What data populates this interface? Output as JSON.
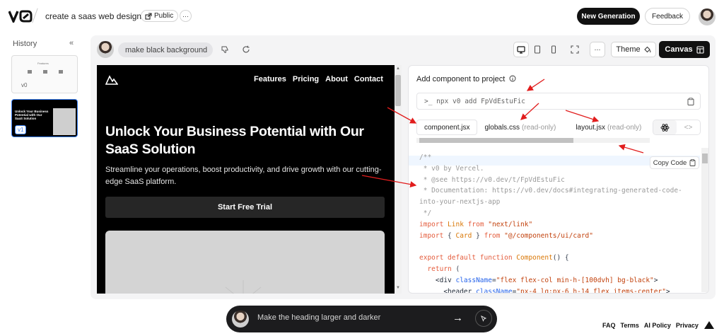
{
  "header": {
    "project_title": "create a saas web design",
    "public_label": "Public",
    "more_label": "···",
    "new_generation_label": "New Generation",
    "feedback_label": "Feedback"
  },
  "history": {
    "title": "History",
    "collapse_icon": "«",
    "items": [
      {
        "version": "v0"
      },
      {
        "version": "v1",
        "thumb_heading": "Unlock Your Business Potential with Our SaaS Solution"
      }
    ],
    "thumb1_title": "Features"
  },
  "toolbar": {
    "prompt_label": "make black background",
    "theme_label": "Theme",
    "canvas_label": "Canvas",
    "more_label": "···"
  },
  "preview": {
    "nav": [
      "Features",
      "Pricing",
      "About",
      "Contact"
    ],
    "heading": "Unlock Your Business Potential with Our SaaS Solution",
    "subheading": "Streamline your operations, boost productivity, and drive growth with our cutting-edge SaaS platform.",
    "cta_label": "Start Free Trial"
  },
  "code_panel": {
    "add_title": "Add component to project",
    "command": ">_  npx v0 add FpVdEstuFic",
    "tabs": [
      {
        "label": "component.jsx",
        "readonly": ""
      },
      {
        "label": "globals.css",
        "readonly": "(read-only)"
      },
      {
        "label": "layout.jsx",
        "readonly": "(read-only)"
      }
    ],
    "copy_label": "Copy Code",
    "code_lines": [
      [
        {
          "t": "/**",
          "c": "com"
        }
      ],
      [
        {
          "t": " * v0 by Vercel.",
          "c": "com"
        }
      ],
      [
        {
          "t": " * @see https://v0.dev/t/FpVdEstuFic",
          "c": "com"
        }
      ],
      [
        {
          "t": " * Documentation: https://v0.dev/docs#integrating-generated-code-",
          "c": "com"
        }
      ],
      [
        {
          "t": "into-your-nextjs-app",
          "c": "com"
        }
      ],
      [
        {
          "t": " */",
          "c": "com"
        }
      ],
      [
        {
          "t": "import ",
          "c": "kw"
        },
        {
          "t": "Link ",
          "c": "fn"
        },
        {
          "t": "from ",
          "c": "kw"
        },
        {
          "t": "\"next/link\"",
          "c": "str"
        }
      ],
      [
        {
          "t": "import ",
          "c": "kw"
        },
        {
          "t": "{ ",
          "c": "plain"
        },
        {
          "t": "Card ",
          "c": "fn"
        },
        {
          "t": "} ",
          "c": "plain"
        },
        {
          "t": "from ",
          "c": "kw"
        },
        {
          "t": "\"@/components/ui/card\"",
          "c": "str"
        }
      ],
      [
        {
          "t": "",
          "c": "plain"
        }
      ],
      [
        {
          "t": "export default function ",
          "c": "kw"
        },
        {
          "t": "Component",
          "c": "fn"
        },
        {
          "t": "() {",
          "c": "plain"
        }
      ],
      [
        {
          "t": "  return ",
          "c": "kw"
        },
        {
          "t": "(",
          "c": "plain"
        }
      ],
      [
        {
          "t": "    <div ",
          "c": "tag"
        },
        {
          "t": "className",
          "c": "attr"
        },
        {
          "t": "=",
          "c": "plain"
        },
        {
          "t": "\"flex flex-col min-h-[100dvh] bg-black\"",
          "c": "str"
        },
        {
          "t": ">",
          "c": "tag"
        }
      ],
      [
        {
          "t": "      <header ",
          "c": "tag"
        },
        {
          "t": "className",
          "c": "attr"
        },
        {
          "t": "=",
          "c": "plain"
        },
        {
          "t": "\"px-4 lg:px-6 h-14 flex items-center\"",
          "c": "str"
        },
        {
          "t": ">",
          "c": "tag"
        }
      ]
    ]
  },
  "chat": {
    "input_value": "Make the heading larger and darker"
  },
  "footer": {
    "links": [
      "FAQ",
      "Terms",
      "AI Policy",
      "Privacy"
    ]
  },
  "colors": {
    "accent": "#3b82f6",
    "annotation_arrow": "#e11d1d",
    "dark": "#111111"
  }
}
